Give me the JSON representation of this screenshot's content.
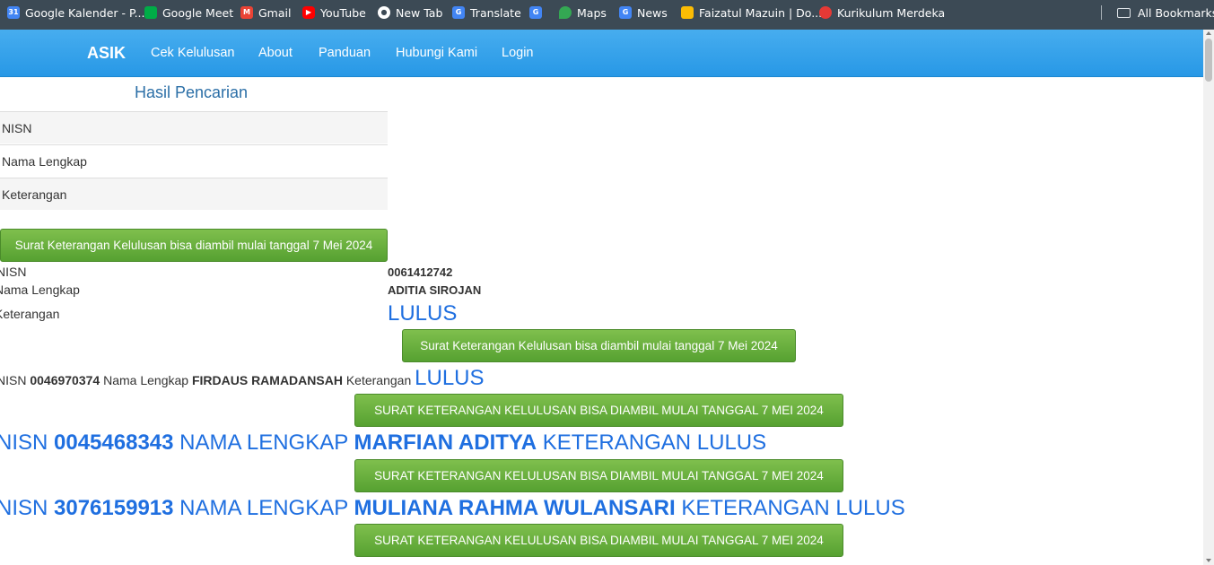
{
  "bookmarks": [
    {
      "label": "Google Kalender - P...",
      "icon": "calendar-icon",
      "color": "#4285f4"
    },
    {
      "label": "Google Meet",
      "icon": "meet-icon",
      "color": "#00ac47"
    },
    {
      "label": "Gmail",
      "icon": "gmail-icon",
      "color": "#ea4335"
    },
    {
      "label": "YouTube",
      "icon": "youtube-icon",
      "color": "#ff0000"
    },
    {
      "label": "New Tab",
      "icon": "globe-icon",
      "color": "#ffffff"
    },
    {
      "label": "Translate",
      "icon": "translate-icon",
      "color": "#4285f4"
    },
    {
      "label": "",
      "icon": "translate-icon",
      "color": "#4285f4"
    },
    {
      "label": "Maps",
      "icon": "maps-icon",
      "color": "#34a853"
    },
    {
      "label": "News",
      "icon": "news-icon",
      "color": "#4285f4"
    },
    {
      "label": "Faizatul Mazuin | Do...",
      "icon": "drive-icon",
      "color": "#fbbc04"
    },
    {
      "label": "Kurikulum Merdeka",
      "icon": "kurikulum-icon",
      "color": "#e53935"
    }
  ],
  "all_bookmarks_label": "All Bookmarks",
  "navbar": {
    "brand": "ASIK",
    "links": [
      "Cek Kelulusan",
      "About",
      "Panduan",
      "Hubungi Kami",
      "Login"
    ]
  },
  "results": {
    "title": "Hasil Pencarian",
    "table_labels": [
      "NISN",
      "Nama Lengkap",
      "Keterangan"
    ],
    "notice": "Surat Keterangan Kelulusan bisa diambil mulai tanggal 7 Mei 2024"
  },
  "students": [
    {
      "nisn_label": "NISN",
      "nisn": "0061412742",
      "name_label": "Nama Lengkap",
      "name": "ADITIA SIROJAN",
      "ket_label": "Keterangan",
      "status": "LULUS"
    },
    {
      "nisn_label": "NISN",
      "nisn": "0046970374",
      "name_label": "Nama Lengkap",
      "name": "FIRDAUS RAMADANSAH",
      "ket_label": "Keterangan",
      "status": "LULUS"
    },
    {
      "nisn_label": "NISN",
      "nisn": "0045468343",
      "name_label": "NAMA LENGKAP",
      "name": "MARFIAN ADITYA",
      "ket_label": "KETERANGAN",
      "status": "LULUS"
    },
    {
      "nisn_label": "NISN",
      "nisn": "3076159913",
      "name_label": "NAMA LENGKAP",
      "name": "MULIANA RAHMA WULANSARI",
      "ket_label": "KETERANGAN",
      "status": "LULUS"
    }
  ],
  "colors": {
    "navbar": "#2798e6",
    "button_green": "#56a131",
    "status_blue": "#1f6fe0",
    "bookmark_bar": "#3c4a55"
  }
}
